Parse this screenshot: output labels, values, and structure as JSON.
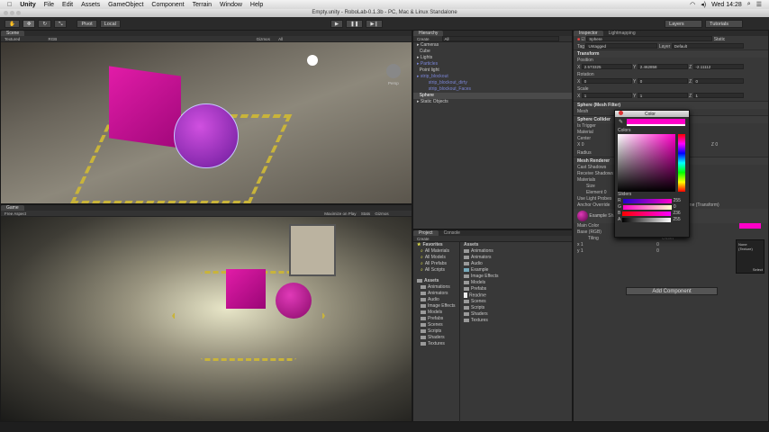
{
  "menubar": {
    "apple": "",
    "app": "Unity",
    "items": [
      "File",
      "Edit",
      "Assets",
      "GameObject",
      "Component",
      "Terrain",
      "Window",
      "Help"
    ],
    "clock": "Wed 14:28"
  },
  "window": {
    "title": "Empty.unity - RoboLab-0.1.3b - PC, Mac & Linux Standalone"
  },
  "toolbar": {
    "pivot": "Pivot",
    "local": "Local",
    "layers": "Layers",
    "layout": "Tutorials"
  },
  "scene": {
    "tab": "Scene",
    "shading": "Textured",
    "mode": "RGB",
    "gizmos": "Gizmos",
    "search": "All",
    "persp": "Persp"
  },
  "game": {
    "tab": "Game",
    "aspect": "Free Aspect",
    "maximize": "Maximize on Play",
    "stats": "Stats",
    "gizmos": "Gizmos"
  },
  "hierarchy": {
    "tab": "Hierarchy",
    "create": "Create",
    "search": "All",
    "items": [
      {
        "label": "Cameras",
        "level": 0,
        "fold": true,
        "blue": false
      },
      {
        "label": "Cube",
        "level": 0,
        "fold": false,
        "blue": false
      },
      {
        "label": "Lights",
        "level": 0,
        "fold": true,
        "blue": false
      },
      {
        "label": "Particles",
        "level": 0,
        "fold": true,
        "blue": true
      },
      {
        "label": "Point light",
        "level": 0,
        "fold": false,
        "blue": false
      },
      {
        "label": "strip_blockout",
        "level": 0,
        "fold": true,
        "blue": true
      },
      {
        "label": "strip_blockout_dirty",
        "level": 1,
        "fold": false,
        "blue": true
      },
      {
        "label": "strip_blockout_Faces",
        "level": 1,
        "fold": false,
        "blue": true
      },
      {
        "label": "Sphere",
        "level": 0,
        "fold": false,
        "blue": false,
        "selected": true
      },
      {
        "label": "Static Objects",
        "level": 0,
        "fold": true,
        "blue": false
      }
    ]
  },
  "project": {
    "tab": "Project",
    "console_tab": "Console",
    "create": "Create",
    "favorites": "Favorites",
    "fav_items": [
      "All Materials",
      "All Models",
      "All Prefabs",
      "All Scripts"
    ],
    "assets": "Assets",
    "tree": [
      "Animations",
      "Animators",
      "Audio",
      "Image Effects",
      "Models",
      "Prefabs",
      "Scenes",
      "Scripts",
      "Shaders",
      "Textures"
    ],
    "breadcrumb": "Assets",
    "files": [
      "Animations",
      "Animators",
      "Audio",
      "Example",
      "Image Effects",
      "Models",
      "Prefabs",
      "Readme",
      "Scenes",
      "Scripts",
      "Shaders",
      "Textures"
    ]
  },
  "inspector": {
    "tab": "Inspector",
    "lightmap_tab": "Lightmapping",
    "name": "Sphere",
    "static": "Static",
    "tag_label": "Tag",
    "tag": "Untagged",
    "layer_label": "Layer",
    "layer": "Default",
    "transform": "Transform",
    "position": "Position",
    "pos": [
      "2.573325",
      "2.462858",
      "-2.11112"
    ],
    "rotation": "Rotation",
    "rot": [
      "0",
      "0",
      "0"
    ],
    "scale": "Scale",
    "scl": [
      "1",
      "1",
      "1"
    ],
    "x": "X",
    "y": "Y",
    "z": "Z",
    "mesh_filter": "Sphere (Mesh Filter)",
    "mesh": "Mesh",
    "collider": "Sphere Collider",
    "is_trigger": "Is Trigger",
    "material": "Material",
    "center": "Center",
    "radius": "Radius",
    "renderer": "Mesh Renderer",
    "cast": "Cast Shadows",
    "receive": "Receive Shadows",
    "materials": "Materials",
    "size": "Size",
    "element": "Element 0",
    "probes": "Use Light Probes",
    "anchor": "Anchor Override",
    "none_transform": "None (Transform)",
    "mat_name": "Example",
    "shader": "Shader",
    "main_color": "Main Color",
    "base": "Base (RGB)",
    "tiling": "Tiling",
    "offset": "Offset",
    "none_texture": "None (Texture)",
    "select": "Select",
    "add": "Add Component"
  },
  "color_picker": {
    "title": "Color",
    "colors": "Colors",
    "sliders": "Sliders",
    "channels": [
      {
        "n": "R",
        "v": "255"
      },
      {
        "n": "G",
        "v": "0"
      },
      {
        "n": "B",
        "v": "236"
      },
      {
        "n": "A",
        "v": "255"
      }
    ],
    "color": "#ff00c8"
  }
}
